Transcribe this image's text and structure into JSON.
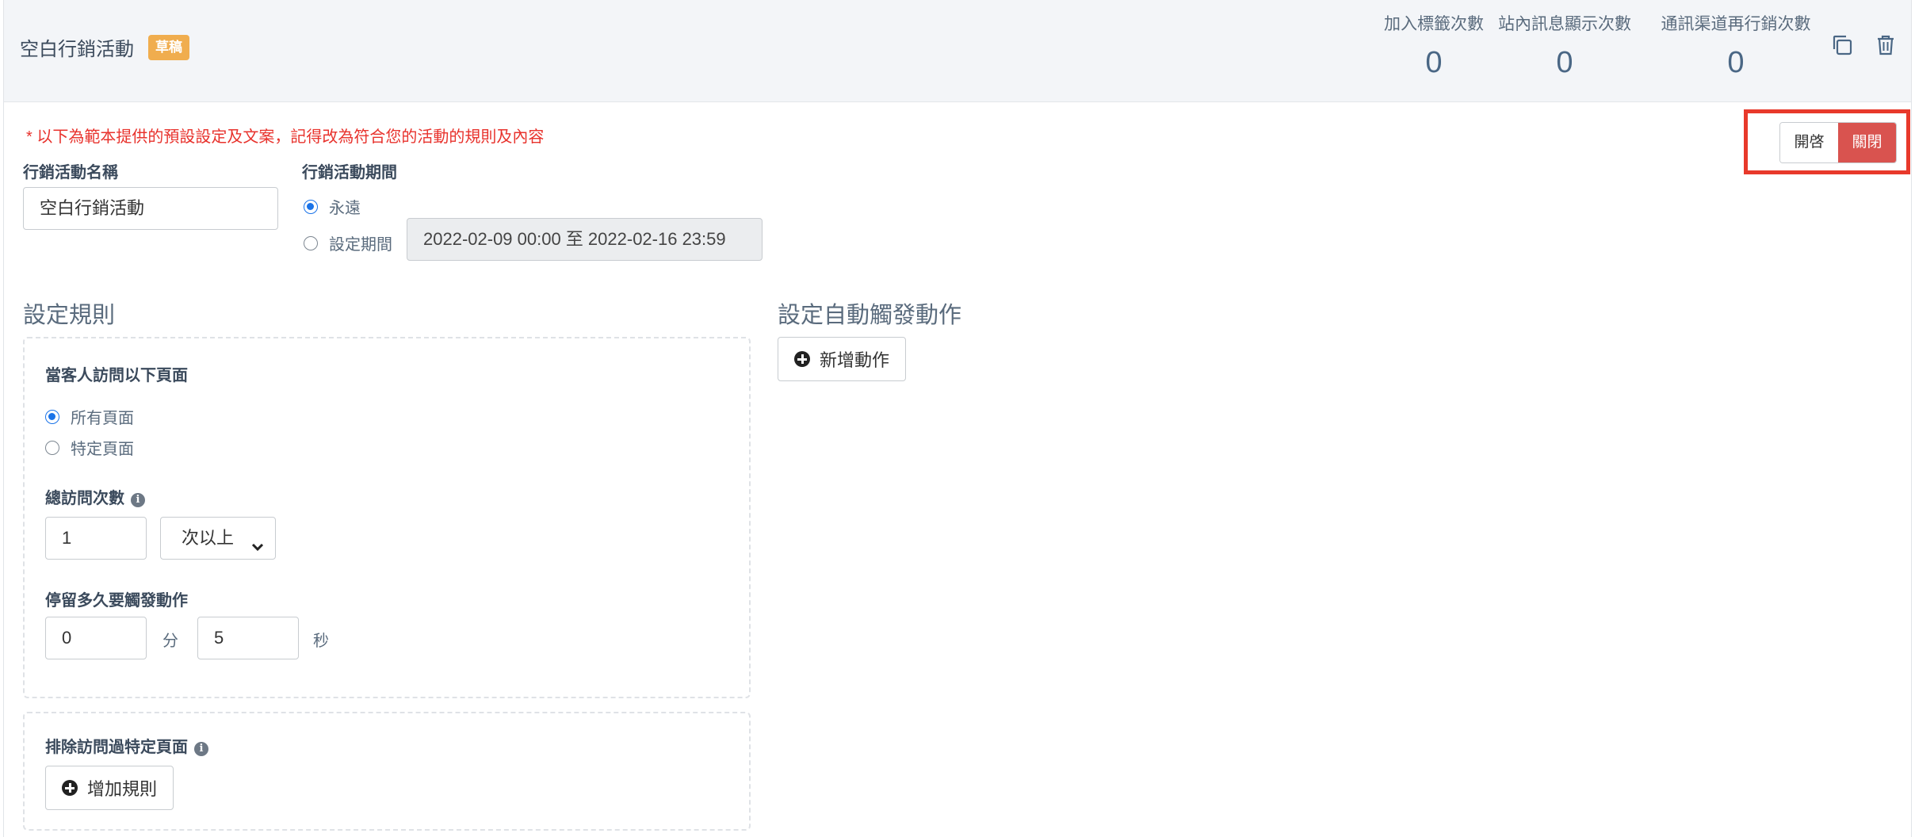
{
  "campaign": {
    "title": "空白行銷活動",
    "status_badge": "草稿"
  },
  "stats": [
    {
      "label": "加入標籤次數",
      "value": "0"
    },
    {
      "label": "站內訊息顯示次數",
      "value": "0"
    },
    {
      "label": "通訊渠道再行銷次數",
      "value": "0"
    }
  ],
  "header_actions": {
    "copy_icon": "copy-icon",
    "delete_icon": "trash-icon"
  },
  "notice": "* 以下為範本提供的預設設定及文案，記得改為符合您的活動的規則及內容",
  "toggle": {
    "on_label": "開啓",
    "off_label": "關閉",
    "active": "off"
  },
  "form": {
    "name_label": "行銷活動名稱",
    "name_value": "空白行銷活動",
    "period_label": "行銷活動期間",
    "period_options": [
      {
        "label": "永遠",
        "checked": true
      },
      {
        "label": "設定期間",
        "checked": false
      }
    ],
    "period_range": "2022-02-09 00:00 至 2022-02-16 23:59"
  },
  "rules": {
    "section_title": "設定規則",
    "visit_pages_label": "當客人訪問以下頁面",
    "page_options": [
      {
        "label": "所有頁面",
        "checked": true
      },
      {
        "label": "特定頁面",
        "checked": false
      }
    ],
    "total_visits_label": "總訪問次數",
    "total_visits_value": "1",
    "total_visits_select": "次以上",
    "stay_label": "停留多久要觸發動作",
    "stay_minutes": "0",
    "minutes_unit": "分",
    "stay_seconds": "5",
    "seconds_unit": "秒",
    "exclude_label": "排除訪問過特定頁面",
    "add_rule_button": "增加規則"
  },
  "actions": {
    "section_title": "設定自動觸發動作",
    "add_action_button": "新增動作"
  },
  "colors": {
    "badge": "#f0ad4e",
    "toggle_off_active": "#d9534f",
    "notice": "#e8322c",
    "highlight_outline": "#e8392b",
    "radio_accent": "#1a73e8"
  }
}
